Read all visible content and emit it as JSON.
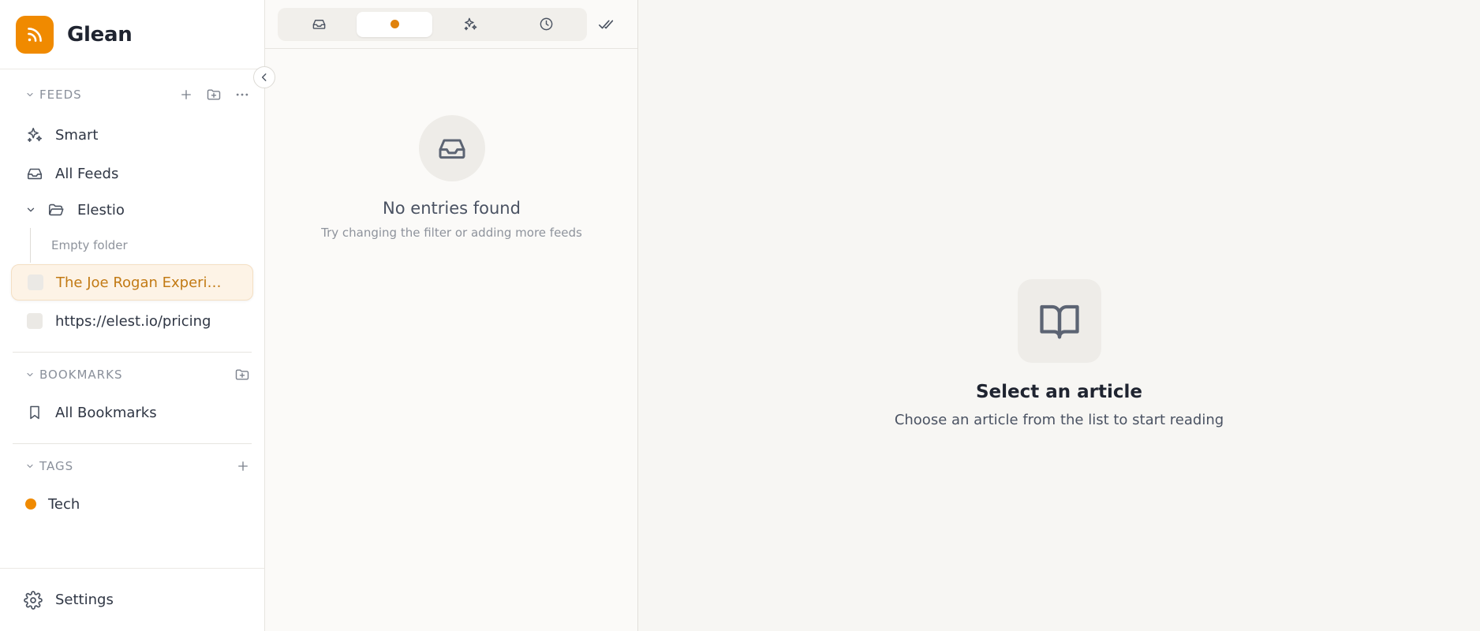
{
  "app": {
    "name": "Glean"
  },
  "sidebar": {
    "feeds_section": {
      "label": "FEEDS"
    },
    "items": {
      "smart": "Smart",
      "all_feeds": "All Feeds",
      "folder": "Elestio",
      "empty_folder": "Empty folder",
      "feed_active": "The Joe Rogan Experi…",
      "feed_pricing": "https://elest.io/pricing"
    },
    "bookmarks_section": {
      "label": "BOOKMARKS"
    },
    "all_bookmarks": "All Bookmarks",
    "tags_section": {
      "label": "TAGS"
    },
    "tags": [
      {
        "label": "Tech",
        "color": "#f08a00"
      }
    ],
    "settings": "Settings"
  },
  "list": {
    "filters": [
      "inbox-icon",
      "unread-dot",
      "sparkles-icon",
      "clock-icon"
    ],
    "active_filter": 1,
    "empty_title": "No entries found",
    "empty_subtitle": "Try changing the filter or adding more feeds"
  },
  "reader": {
    "title": "Select an article",
    "subtitle": "Choose an article from the list to start reading"
  },
  "colors": {
    "accent": "#f08a00",
    "active_text": "#c27a14",
    "active_bg": "#fdf3e6"
  }
}
